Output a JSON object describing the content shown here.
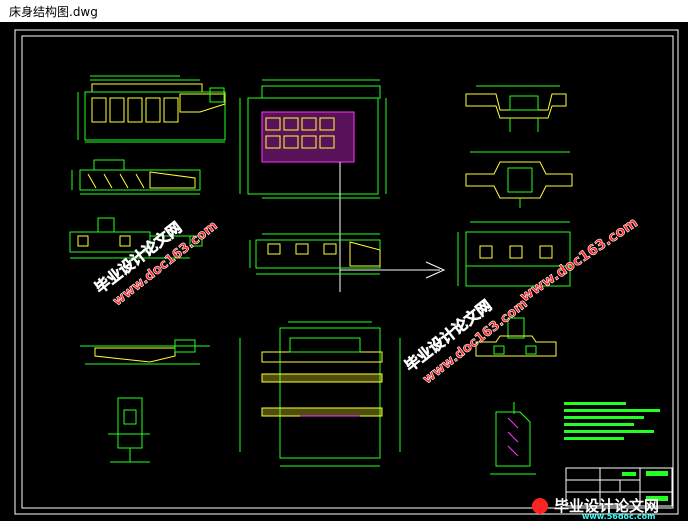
{
  "window": {
    "title": "床身结构图.dwg"
  },
  "colors": {
    "background": "#000000",
    "line_green": "#22ff22",
    "line_yellow": "#ffff33",
    "line_magenta": "#ff33ff",
    "line_white": "#ffffff",
    "line_cyan": "#33ffff"
  },
  "watermarks": {
    "site_cn": "毕业设计论文网",
    "site_url": "www.doc163.com",
    "footer_cn": "毕业设计论文网",
    "footer_url": "www.56doc.com"
  }
}
